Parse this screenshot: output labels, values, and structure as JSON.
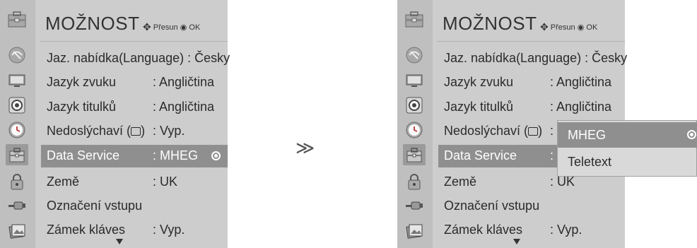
{
  "menu": {
    "title": "MOŽNOST",
    "hint_move": "Přesun",
    "hint_ok": "OK",
    "rows": [
      {
        "label": "Jaz. nabídka(Language) : Česky",
        "value": ""
      },
      {
        "label": "Jazyk zvuku",
        "value": ": Angličtina"
      },
      {
        "label": "Jazyk titulků",
        "value": ": Angličtina"
      },
      {
        "label_a": "Nedoslýchaví (",
        "label_b": ")",
        "value": ": Vyp."
      },
      {
        "label": "Data Service",
        "value": ": MHEG"
      },
      {
        "label": "Země",
        "value": ": UK"
      },
      {
        "label": "Označení vstupu",
        "value": ""
      },
      {
        "label": "Zámek kláves",
        "value": ": Vyp."
      }
    ]
  },
  "right_panel": {
    "hidden_value_fragment": ":",
    "zeme_value_fragment": ": UK"
  },
  "transition_symbol": "≫",
  "popup": {
    "options": [
      "MHEG",
      "Teletext"
    ]
  },
  "icons": {
    "header": "option-toolbox-icon",
    "side": [
      "satellite-icon",
      "monitor-icon",
      "speaker-icon",
      "clock-icon",
      "toolbox-icon",
      "lock-icon",
      "input-plug-icon",
      "usb-photo-icon"
    ]
  },
  "colors": {
    "panel_bg": "#cdcdcd",
    "icon_column_bg": "#bfbfbf",
    "selected_row": "#8f8f8f"
  }
}
